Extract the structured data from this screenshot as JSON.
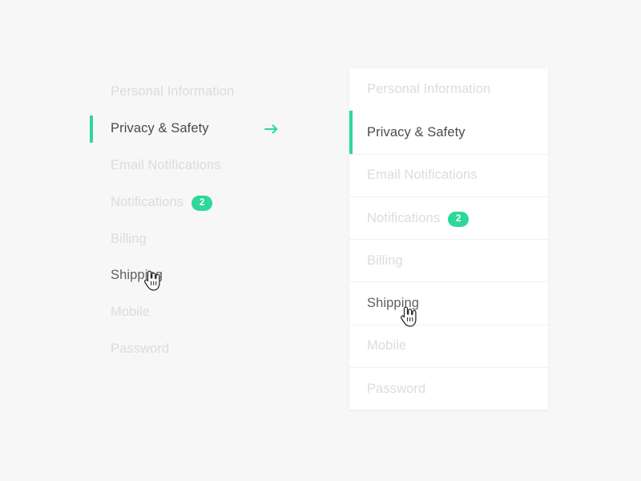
{
  "theme": {
    "background": "#f7f7f8",
    "card_background": "#ffffff",
    "accent": "#2ed89a",
    "text_inactive": "#dcdcde",
    "text_active": "#4b4b4d",
    "text_hover": "#5f5f62",
    "divider": "#f0f0f1"
  },
  "menu": {
    "items": [
      {
        "label": "Personal Information",
        "state": "default",
        "badge": null,
        "arrow": false
      },
      {
        "label": "Privacy & Safety",
        "state": "active",
        "badge": null,
        "arrow": true
      },
      {
        "label": "Email Notifications",
        "state": "default",
        "badge": null,
        "arrow": false
      },
      {
        "label": "Notifications",
        "state": "default",
        "badge": "2",
        "arrow": false
      },
      {
        "label": "Billing",
        "state": "default",
        "badge": null,
        "arrow": false
      },
      {
        "label": "Shipping",
        "state": "hover",
        "badge": null,
        "arrow": false
      },
      {
        "label": "Mobile",
        "state": "default",
        "badge": null,
        "arrow": false
      },
      {
        "label": "Password",
        "state": "default",
        "badge": null,
        "arrow": false
      }
    ]
  },
  "card_menu": {
    "items": [
      {
        "label": "Personal Information",
        "state": "default",
        "badge": null,
        "arrow": false
      },
      {
        "label": "Privacy & Safety",
        "state": "active",
        "badge": null,
        "arrow": true
      },
      {
        "label": "Email Notifications",
        "state": "default",
        "badge": null,
        "arrow": false
      },
      {
        "label": "Notifications",
        "state": "default",
        "badge": "2",
        "arrow": false
      },
      {
        "label": "Billing",
        "state": "default",
        "badge": null,
        "arrow": false
      },
      {
        "label": "Shipping",
        "state": "hover",
        "badge": null,
        "arrow": false
      },
      {
        "label": "Mobile",
        "state": "default",
        "badge": null,
        "arrow": false
      },
      {
        "label": "Password",
        "state": "default",
        "badge": null,
        "arrow": false
      }
    ]
  },
  "icons": {
    "arrow": "arrow-right-icon",
    "cursor": "hand-pointer-cursor"
  }
}
